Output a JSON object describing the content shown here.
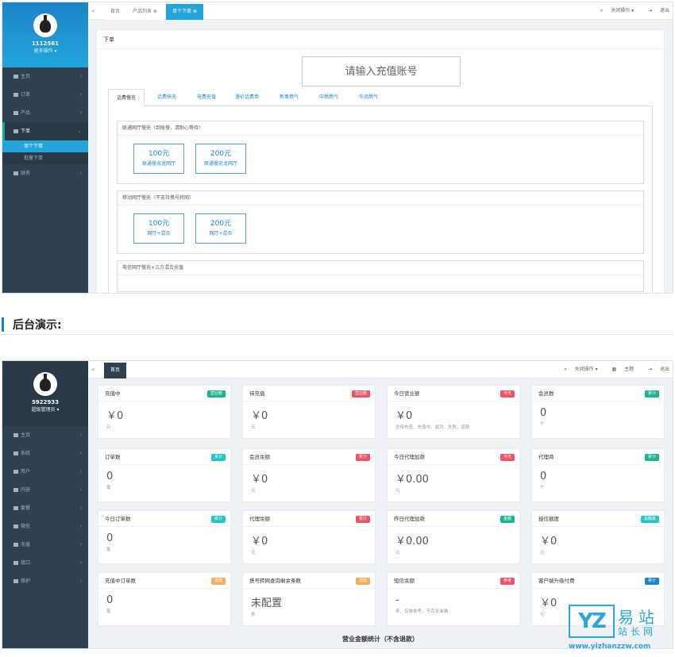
{
  "shot1": {
    "sidebar": {
      "user_id": "1112561",
      "more_ops": "更多操作 ▾",
      "items": [
        {
          "label": "主页"
        },
        {
          "label": "订单"
        },
        {
          "label": "产品"
        },
        {
          "label": "下单"
        },
        {
          "label": "单个下单"
        },
        {
          "label": "批量下单"
        },
        {
          "label": "财务"
        }
      ]
    },
    "tabs": [
      {
        "label": "首页"
      },
      {
        "label": "产品列表 ⊗"
      },
      {
        "label": "单个下单 ⊗"
      }
    ],
    "topbar_right": {
      "ops": "关闭操作 ▾",
      "exit": "退出"
    },
    "panel_title": "下单",
    "account_placeholder": "请输入充值账号",
    "content_tabs": [
      "话费慢充",
      "话费快充",
      "电费充值",
      "漫价话费单",
      "新奥燃气",
      "中燃燃气",
      "华润燃气"
    ],
    "groups": [
      {
        "title": "联通网厅慢充（到账慢，请耐心等待）",
        "products": [
          {
            "amount": "100元",
            "desc": "联通慢充龙网厅"
          },
          {
            "amount": "200元",
            "desc": "联通慢充龙网厅"
          }
        ]
      },
      {
        "title": "移动网厅慢充（不支持携号转网）",
        "products": [
          {
            "amount": "100元",
            "desc": "网厅+混合"
          },
          {
            "amount": "200元",
            "desc": "网厅+混合"
          }
        ]
      },
      {
        "title": "电信网厅慢充+三方混合充值",
        "products": []
      }
    ]
  },
  "heading": "后台演示:",
  "shot2": {
    "sidebar": {
      "user_id": "5922933",
      "role": "超级管理员 ▾",
      "items": [
        {
          "label": "主页"
        },
        {
          "label": "系统"
        },
        {
          "label": "用户"
        },
        {
          "label": "内容"
        },
        {
          "label": "套餐"
        },
        {
          "label": "微信"
        },
        {
          "label": "充值"
        },
        {
          "label": "接口"
        },
        {
          "label": "维护"
        }
      ]
    },
    "tabs": [
      {
        "label": "首页"
      }
    ],
    "topbar_right": {
      "ops": "关闭操作 ▾",
      "theme": "主题",
      "exit": "退出"
    },
    "cards": [
      {
        "title": "充值中",
        "badge": "营业额",
        "badge_color": "#1ab394",
        "value": "￥0",
        "unit": "元"
      },
      {
        "title": "待充值",
        "badge": "营业额",
        "badge_color": "#ed5565",
        "value": "￥0",
        "unit": "元"
      },
      {
        "title": "今日营业额",
        "badge": "今天",
        "badge_color": "#ed5565",
        "value": "￥0",
        "unit": "含待充值、充值中、成功、失败、退款"
      },
      {
        "title": "会员数",
        "badge": "累计",
        "badge_color": "#1ab394",
        "value": "0",
        "unit": "个"
      },
      {
        "title": "订单数",
        "badge": "累计",
        "badge_color": "#23c6c8",
        "value": "0",
        "unit": "笔"
      },
      {
        "title": "会员余额",
        "badge": "累计",
        "badge_color": "#ed5565",
        "value": "￥0",
        "unit": "元"
      },
      {
        "title": "今日代理加款",
        "badge": "今天",
        "badge_color": "#ed5565",
        "value": "￥0.00",
        "unit": "元"
      },
      {
        "title": "代理商",
        "badge": "累计",
        "badge_color": "#1ab394",
        "value": "0",
        "unit": "个"
      },
      {
        "title": "今日订单数",
        "badge": "累计",
        "badge_color": "#23c6c8",
        "value": "0",
        "unit": "笔"
      },
      {
        "title": "代理余额",
        "badge": "累计",
        "badge_color": "#ed5565",
        "value": "￥0",
        "unit": "元"
      },
      {
        "title": "昨日代理加款",
        "badge": "金额",
        "badge_color": "#1ab394",
        "value": "￥0.00",
        "unit": "元"
      },
      {
        "title": "授信额度",
        "badge": "总额度",
        "badge_color": "#23c6c8",
        "value": "￥0",
        "unit": "元"
      },
      {
        "title": "充值中订单数",
        "badge": "当前",
        "badge_color": "#f8ac59",
        "value": "0",
        "unit": "笔"
      },
      {
        "title": "携号转网查询剩余条数",
        "badge": "当前",
        "badge_color": "#f8ac59",
        "value": "未配置",
        "unit": "条"
      },
      {
        "title": "短信余额",
        "badge": "参考",
        "badge_color": "#ed5565",
        "value": "-",
        "unit": "条，仅做参考，不完全准确"
      },
      {
        "title": "客户端升级付费",
        "badge": "累计",
        "badge_color": "#1c84c6",
        "value": "￥0",
        "unit": "元"
      }
    ],
    "footer": "营业金额统计（不含退款）"
  },
  "watermark": {
    "box": "YZ",
    "cn1": "易站",
    "cn2": "站长网",
    "url": "www.yizhanzzw.com"
  }
}
